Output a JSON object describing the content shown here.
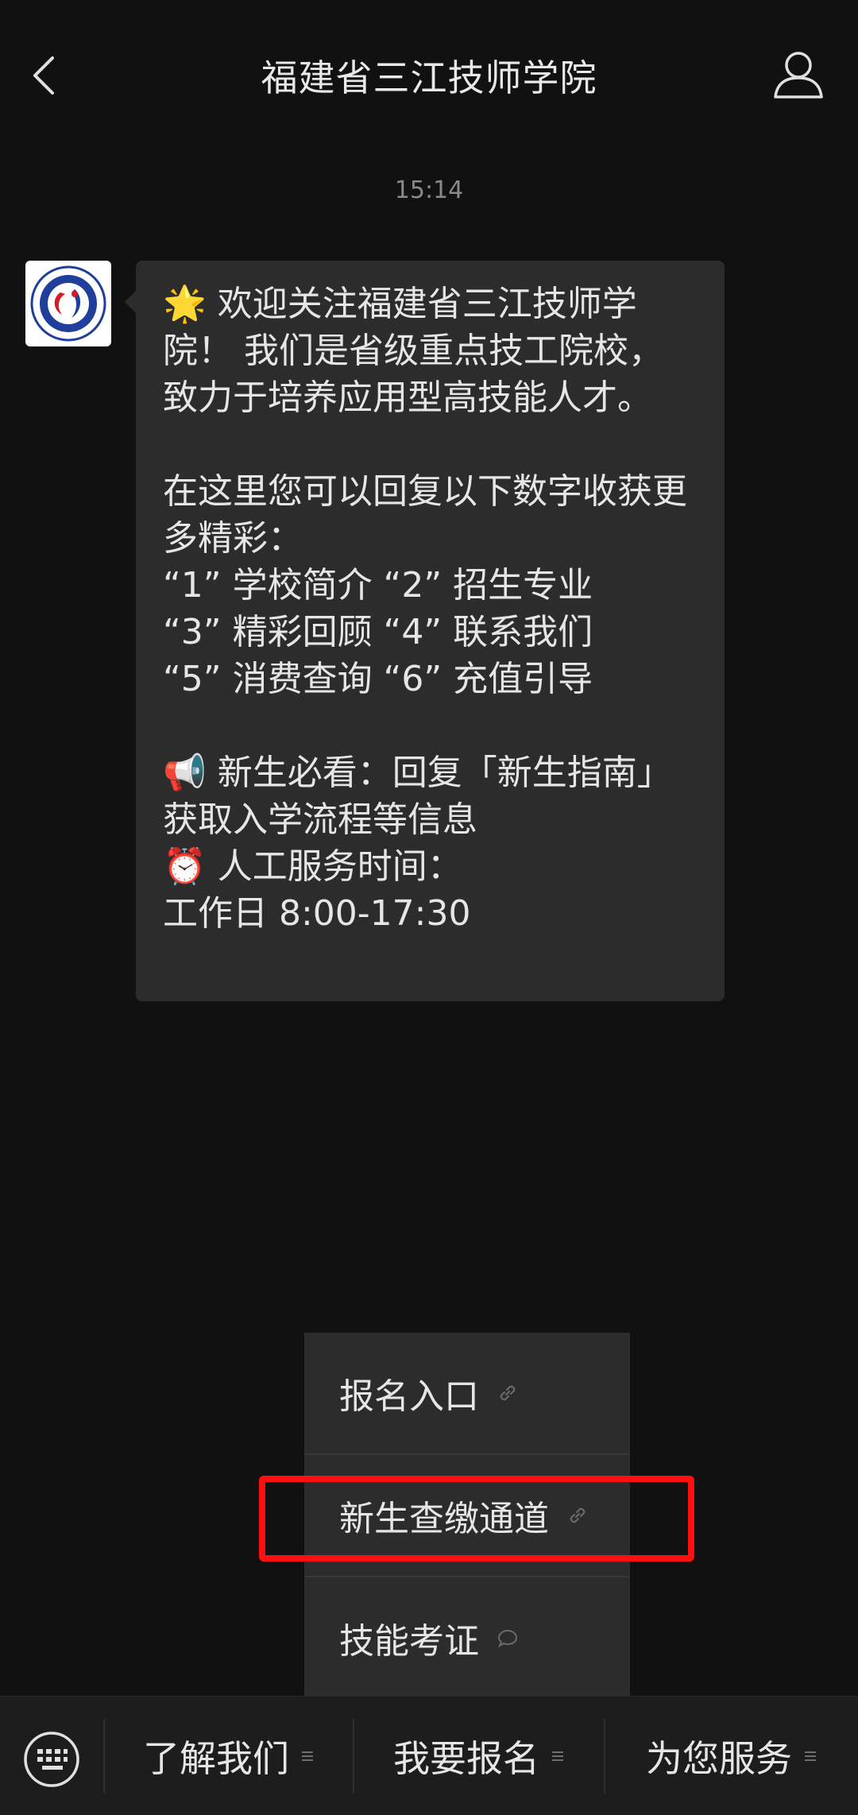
{
  "header": {
    "title": "福建省三江技师学院",
    "back_icon": "chevron-left-icon",
    "profile_icon": "person-icon"
  },
  "chat": {
    "timestamp": "15:14",
    "message": {
      "lines": [
        "🌟 欢迎关注福建省三江技师学",
        "院！ 我们是省级重点技工院校，",
        "致力于培养应用型高技能人才。",
        "",
        "在这里您可以回复以下数字收获更",
        "多精彩：",
        "“1” 学校简介 “2” 招生专业",
        "“3” 精彩回顾 “4” 联系我们",
        "“5” 消费查询 “6” 充值引导",
        "",
        "📢 新生必看：回复「新生指南」",
        "获取入学流程等信息",
        "⏰ 人工服务时间：",
        "工作日 8:00-17:30"
      ]
    }
  },
  "menu_popup": {
    "items": [
      {
        "label": "报名入口",
        "icon": "link-icon"
      },
      {
        "label": "新生查缴通道",
        "icon": "link-icon"
      },
      {
        "label": "技能考证",
        "icon": "chat-bubble-icon"
      }
    ]
  },
  "bottom_menu": {
    "keyboard_icon": "keyboard-icon",
    "tabs": [
      {
        "label": "了解我们"
      },
      {
        "label": "我要报名"
      },
      {
        "label": "为您服务"
      }
    ]
  },
  "colors": {
    "background": "#111111",
    "bubble": "#2c2c2c",
    "highlight": "#ff0f0f"
  }
}
